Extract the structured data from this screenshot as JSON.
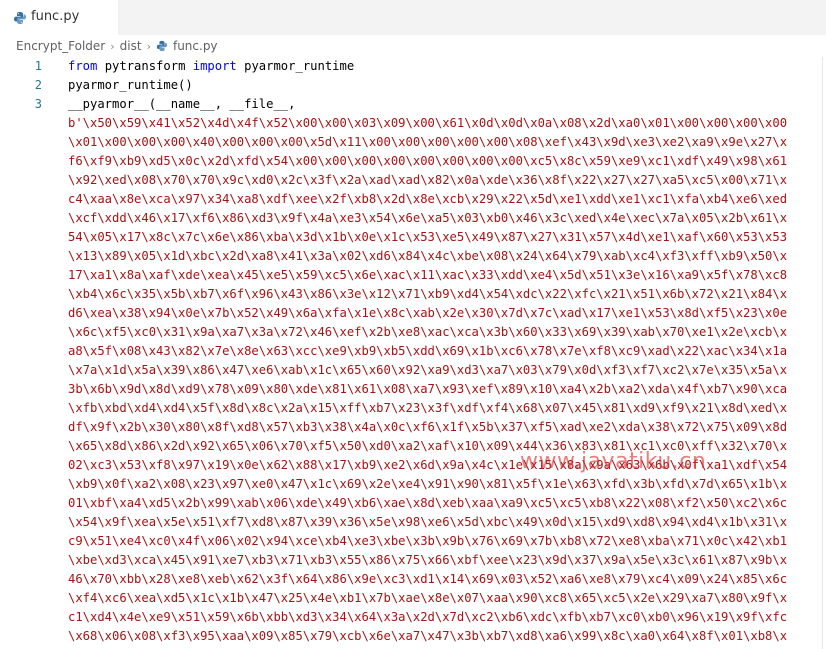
{
  "tab": {
    "label": "func.py",
    "icon": "python-file-icon"
  },
  "breadcrumb": [
    "Encrypt_Folder",
    "dist",
    "func.py"
  ],
  "gutter": [
    "1",
    "2",
    "3"
  ],
  "code": {
    "line1": {
      "from": "from",
      "mod": " pytransform ",
      "import": "import",
      "name": " pyarmor_runtime"
    },
    "line2": "pyarmor_runtime()",
    "line3": "__pyarmor__(__name__, __file__,",
    "bytes": [
      "b'\\x50\\x59\\x41\\x52\\x4d\\x4f\\x52\\x00\\x00\\x03\\x09\\x00\\x61\\x0d\\x0d\\x0a\\x08\\x2d\\xa0\\x01\\x00\\x00\\x00\\x00",
      "\\x01\\x00\\x00\\x00\\x40\\x00\\x00\\x00\\x5d\\x11\\x00\\x00\\x00\\x00\\x00\\x08\\xef\\x43\\x9d\\xe3\\xe2\\xa9\\x9e\\x27\\x",
      "f6\\xf9\\xb9\\xd5\\x0c\\x2d\\xfd\\x54\\x00\\x00\\x00\\x00\\x00\\x00\\x00\\x00\\xc5\\x8c\\x59\\xe9\\xc1\\xdf\\x49\\x98\\x61",
      "\\x92\\xed\\x08\\x70\\x70\\x9c\\xd0\\x2c\\x3f\\x2a\\xad\\xad\\x82\\x0a\\xde\\x36\\x8f\\x22\\x27\\x27\\xa5\\xc5\\x00\\x71\\x",
      "c4\\xaa\\x8e\\xca\\x97\\x34\\xa8\\xdf\\xee\\x2f\\xb8\\x2d\\x8e\\xcb\\x29\\x22\\x5d\\xe1\\xdd\\xe1\\xc1\\xfa\\xb4\\xe6\\xed",
      "\\xcf\\xdd\\x46\\x17\\xf6\\x86\\xd3\\x9f\\x4a\\xe3\\x54\\x6e\\xa5\\x03\\xb0\\x46\\x3c\\xed\\x4e\\xec\\x7a\\x05\\x2b\\x61\\x",
      "54\\x05\\x17\\x8c\\x7c\\x6e\\x86\\xba\\x3d\\x1b\\x0e\\x1c\\x53\\xe5\\x49\\x87\\x27\\x31\\x57\\x4d\\xe1\\xaf\\x60\\x53\\x53",
      "\\x13\\x89\\x05\\x1d\\xbc\\x2d\\xa8\\x41\\x3a\\x02\\xd6\\x84\\x4c\\xbe\\x08\\x24\\x64\\x79\\xab\\xc4\\xf3\\xff\\xb9\\x50\\x",
      "17\\xa1\\x8a\\xaf\\xde\\xea\\x45\\xe5\\x59\\xc5\\x6e\\xac\\x11\\xac\\x33\\xdd\\xe4\\x5d\\x51\\x3e\\x16\\xa9\\x5f\\x78\\xc8",
      "\\xb4\\x6c\\x35\\x5b\\xb7\\x6f\\x96\\x43\\x86\\x3e\\x12\\x71\\xb9\\xd4\\x54\\xdc\\x22\\xfc\\x21\\x51\\x6b\\x72\\x21\\x84\\x",
      "d6\\xea\\x38\\x94\\x0e\\x7b\\x52\\x49\\x6a\\xfa\\x1e\\x8c\\xab\\x2e\\x30\\x7d\\x7c\\xad\\x17\\xe1\\x53\\x8d\\xf5\\x23\\x0e",
      "\\x6c\\xf5\\xc0\\x31\\x9a\\xa7\\x3a\\x72\\x46\\xef\\x2b\\xe8\\xac\\xca\\x3b\\x60\\x33\\x69\\x39\\xab\\x70\\xe1\\x2e\\xcb\\x",
      "a8\\x5f\\x08\\x43\\x82\\x7e\\x8e\\x63\\xcc\\xe9\\xb9\\xb5\\xdd\\x69\\x1b\\xc6\\x78\\x7e\\xf8\\xc9\\xad\\x22\\xac\\x34\\x1a",
      "\\x7a\\x1d\\x5a\\x39\\x86\\x47\\xe6\\xab\\x1c\\x65\\x60\\x92\\xa9\\xd3\\xa7\\x03\\x79\\x0d\\xf3\\xf7\\xc2\\x7e\\x35\\x5a\\x",
      "3b\\x6b\\x9d\\x8d\\xd9\\x78\\x09\\x80\\xde\\x81\\x61\\x08\\xa7\\x93\\xef\\x89\\x10\\xa4\\x2b\\xa2\\xda\\x4f\\xb7\\x90\\xca",
      "\\xfb\\xbd\\xd4\\xd4\\x5f\\x8d\\x8c\\x2a\\x15\\xff\\xb7\\x23\\x3f\\xdf\\xf4\\x68\\x07\\x45\\x81\\xd9\\xf9\\x21\\x8d\\xed\\x",
      "df\\x9f\\x2b\\x30\\x80\\x8f\\xd8\\x57\\xb3\\x38\\x4a\\x0c\\xf6\\x1f\\x5b\\x37\\xf5\\xad\\xe2\\xda\\x38\\x72\\x75\\x09\\x8d",
      "\\x65\\x8d\\x86\\x2d\\x92\\x65\\x06\\x70\\xf5\\x50\\xd0\\xa2\\xaf\\x10\\x09\\x44\\x36\\x83\\x81\\xc1\\xc0\\xff\\x32\\x70\\x",
      "02\\xc3\\x53\\xf8\\x97\\x19\\x0e\\x62\\x88\\x17\\xb9\\xe2\\x6d\\x9a\\x4c\\x1e\\x15\\x8a\\x9a\\x63\\x6b\\x0f\\xa1\\xdf\\x54",
      "\\xb9\\x0f\\xa2\\x08\\x23\\x97\\xe0\\x47\\x1c\\x69\\x2e\\xe4\\x91\\x90\\x81\\x5f\\x1e\\x63\\xfd\\x3b\\xfd\\x7d\\x65\\x1b\\x",
      "01\\xbf\\xa4\\xd5\\x2b\\x99\\xab\\x06\\xde\\x49\\xb6\\xae\\x8d\\xeb\\xaa\\xa9\\xc5\\xc5\\xb8\\x22\\x08\\xf2\\x50\\xc2\\x6c",
      "\\x54\\x9f\\xea\\x5e\\x51\\xf7\\xd8\\x87\\x39\\x36\\x5e\\x98\\xe6\\x5d\\xbc\\x49\\x0d\\x15\\xd9\\xd8\\x94\\xd4\\x1b\\x31\\x",
      "c9\\x51\\xe4\\xc0\\x4f\\x06\\x02\\x94\\xce\\xb4\\xe3\\xbe\\x3b\\x9b\\x76\\x69\\x7b\\xb8\\x72\\xe8\\xba\\x71\\x0c\\x42\\xb1",
      "\\xbe\\xd3\\xca\\x45\\x91\\xe7\\xb3\\x71\\xb3\\x55\\x86\\x75\\x66\\xbf\\xee\\x23\\x9d\\x37\\x9a\\x5e\\x3c\\x61\\x87\\x9b\\x",
      "46\\x70\\xbb\\x28\\xe8\\xeb\\x62\\x3f\\x64\\x86\\x9e\\xc3\\xd1\\x14\\x69\\x03\\x52\\xa6\\xe8\\x79\\xc4\\x09\\x24\\x85\\x6c",
      "\\xf4\\xc6\\xea\\xd5\\x1c\\x1b\\x47\\x25\\x4e\\xb1\\x7b\\xae\\x8e\\x07\\xaa\\x90\\xc8\\x65\\xc5\\x2e\\x29\\xa7\\x80\\x9f\\x",
      "c1\\xd4\\x4e\\xe9\\x51\\x59\\x6b\\xbb\\xd3\\x34\\x64\\x3a\\x2d\\x7d\\xc2\\xb6\\xdc\\xfb\\xb7\\xc0\\xb0\\x96\\x19\\x9f\\xfc",
      "\\x68\\x06\\x08\\xf3\\x95\\xaa\\x09\\x85\\x79\\xcb\\x6e\\xa7\\x47\\x3b\\xb7\\xd8\\xa6\\x99\\x8c\\xa0\\x64\\x8f\\x01\\xb8\\x"
    ]
  },
  "watermark": "www.javatiku.cn",
  "colors": {
    "keyword": "#0000ff",
    "string": "#a31515",
    "line_number": "#237893"
  }
}
